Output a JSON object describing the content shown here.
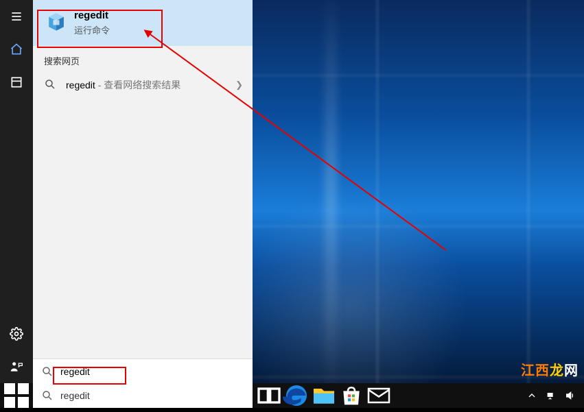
{
  "search": {
    "query": "regedit",
    "best": {
      "title": "regedit",
      "subtitle": "运行命令"
    },
    "web_header": "搜索网页",
    "web_result": {
      "query": "regedit",
      "hint": " - 查看网络搜索结果"
    }
  },
  "taskbar": {
    "search_text": "regedit"
  },
  "watermark": {
    "a": "江西",
    "b": "龙",
    "c": "网"
  }
}
